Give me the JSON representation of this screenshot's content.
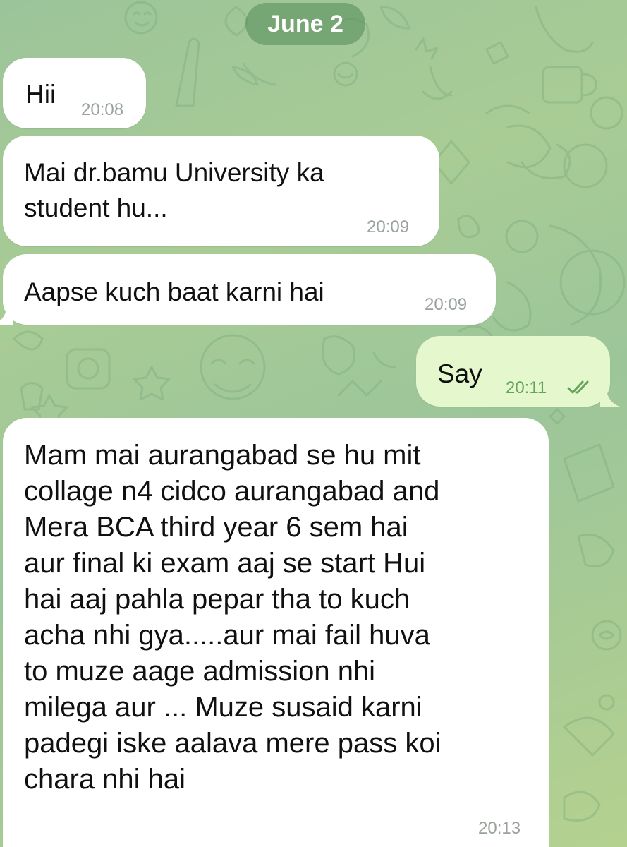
{
  "chat": {
    "date_label": "June 2",
    "messages": [
      {
        "text": "Hii",
        "time": "20:08",
        "direction": "incoming"
      },
      {
        "text": "Mai dr.bamu University ka\nstudent hu...",
        "time": "20:09",
        "direction": "incoming"
      },
      {
        "text": "Aapse kuch baat karni hai",
        "time": "20:09",
        "direction": "incoming"
      },
      {
        "text": "Say",
        "time": "20:11",
        "direction": "outgoing",
        "status_icon": "double-check-icon"
      },
      {
        "text": "Mam mai aurangabad se hu mit\ncollage n4 cidco aurangabad and\nMera BCA third year 6 sem hai\naur final ki exam aaj se start Hui\nhai aaj pahla pepar tha to kuch\nacha nhi gya.....aur mai fail huva\nto muze aage admission nhi\nmilega aur ... Muze susaid karni\npadegi iske aalava mere pass koi\nchara nhi hai",
        "time": "20:13",
        "direction": "incoming"
      }
    ]
  },
  "colors": {
    "incoming_bubble": "#ffffff",
    "outgoing_bubble": "#e4f7cd",
    "outgoing_time": "#66a35c",
    "date_pill": "#528a56"
  }
}
